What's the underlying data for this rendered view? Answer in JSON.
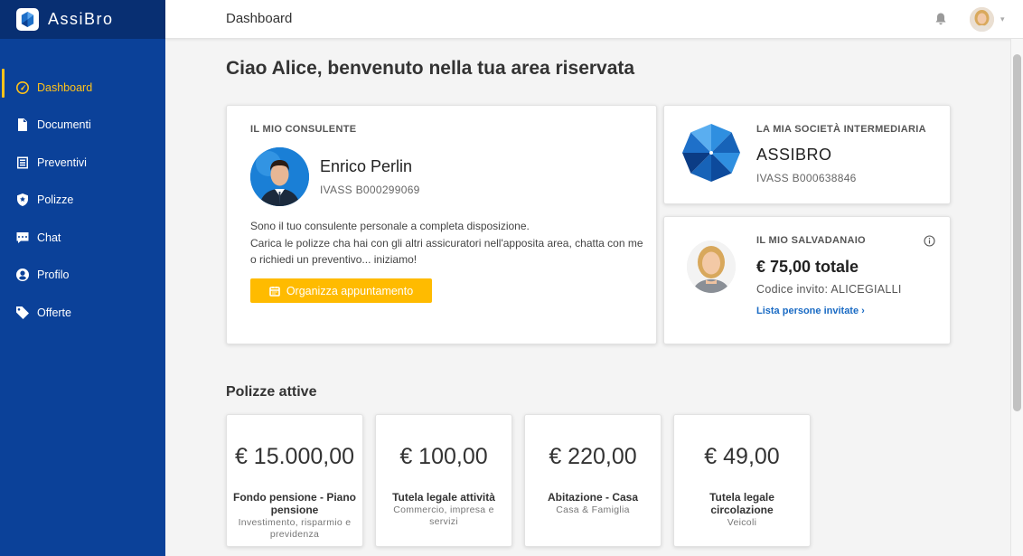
{
  "brand": {
    "name": "AssiBro"
  },
  "sidebar": {
    "items": [
      {
        "label": "Dashboard",
        "icon": "gauge-icon",
        "active": true
      },
      {
        "label": "Documenti",
        "icon": "document-icon"
      },
      {
        "label": "Preventivi",
        "icon": "list-icon"
      },
      {
        "label": "Polizze",
        "icon": "shield-star-icon"
      },
      {
        "label": "Chat",
        "icon": "chat-icon"
      },
      {
        "label": "Profilo",
        "icon": "user-icon"
      },
      {
        "label": "Offerte",
        "icon": "tag-icon"
      }
    ]
  },
  "header": {
    "title": "Dashboard"
  },
  "greeting": {
    "prefix": "Ciao ",
    "name": "Alice",
    "suffix": ", benvenuto nella tua area riservata"
  },
  "consultant": {
    "label": "IL MIO CONSULENTE",
    "name": "Enrico Perlin",
    "ivass": "IVASS B000299069",
    "description_line1": "Sono il tuo consulente personale a completa disposizione.",
    "description_line2": "Carica le polizze cha hai con gli altri assicuratori nell'apposita area, chatta con me o richiedi un preventivo... iniziamo!",
    "button_label": "Organizza appuntamento"
  },
  "company": {
    "label": "LA MIA SOCIETÀ INTERMEDIARIA",
    "name": "ASSIBRO",
    "ivass": "IVASS B000638846"
  },
  "piggy_bank": {
    "label": "IL MIO SALVADANAIO",
    "total": "€ 75,00 totale",
    "invite_code": "Codice invito: ALICEGIALLI",
    "link_label": "Lista persone invitate"
  },
  "policies": {
    "title": "Polizze attive",
    "items": [
      {
        "amount": "€ 15.000,00",
        "name": "Fondo pensione - Piano pensione",
        "sub": "Investimento, risparmio e previdenza"
      },
      {
        "amount": "€ 100,00",
        "name": "Tutela legale attività",
        "sub": "Commercio, impresa e servizi"
      },
      {
        "amount": "€ 220,00",
        "name": "Abitazione - Casa",
        "sub": "Casa & Famiglia"
      },
      {
        "amount": "€ 49,00",
        "name": "Tutela legale circolazione",
        "sub": "Veicoli"
      }
    ]
  },
  "colors": {
    "sidebar": "#0b4199",
    "accent": "#ffbb00",
    "link": "#1a6bc4"
  }
}
